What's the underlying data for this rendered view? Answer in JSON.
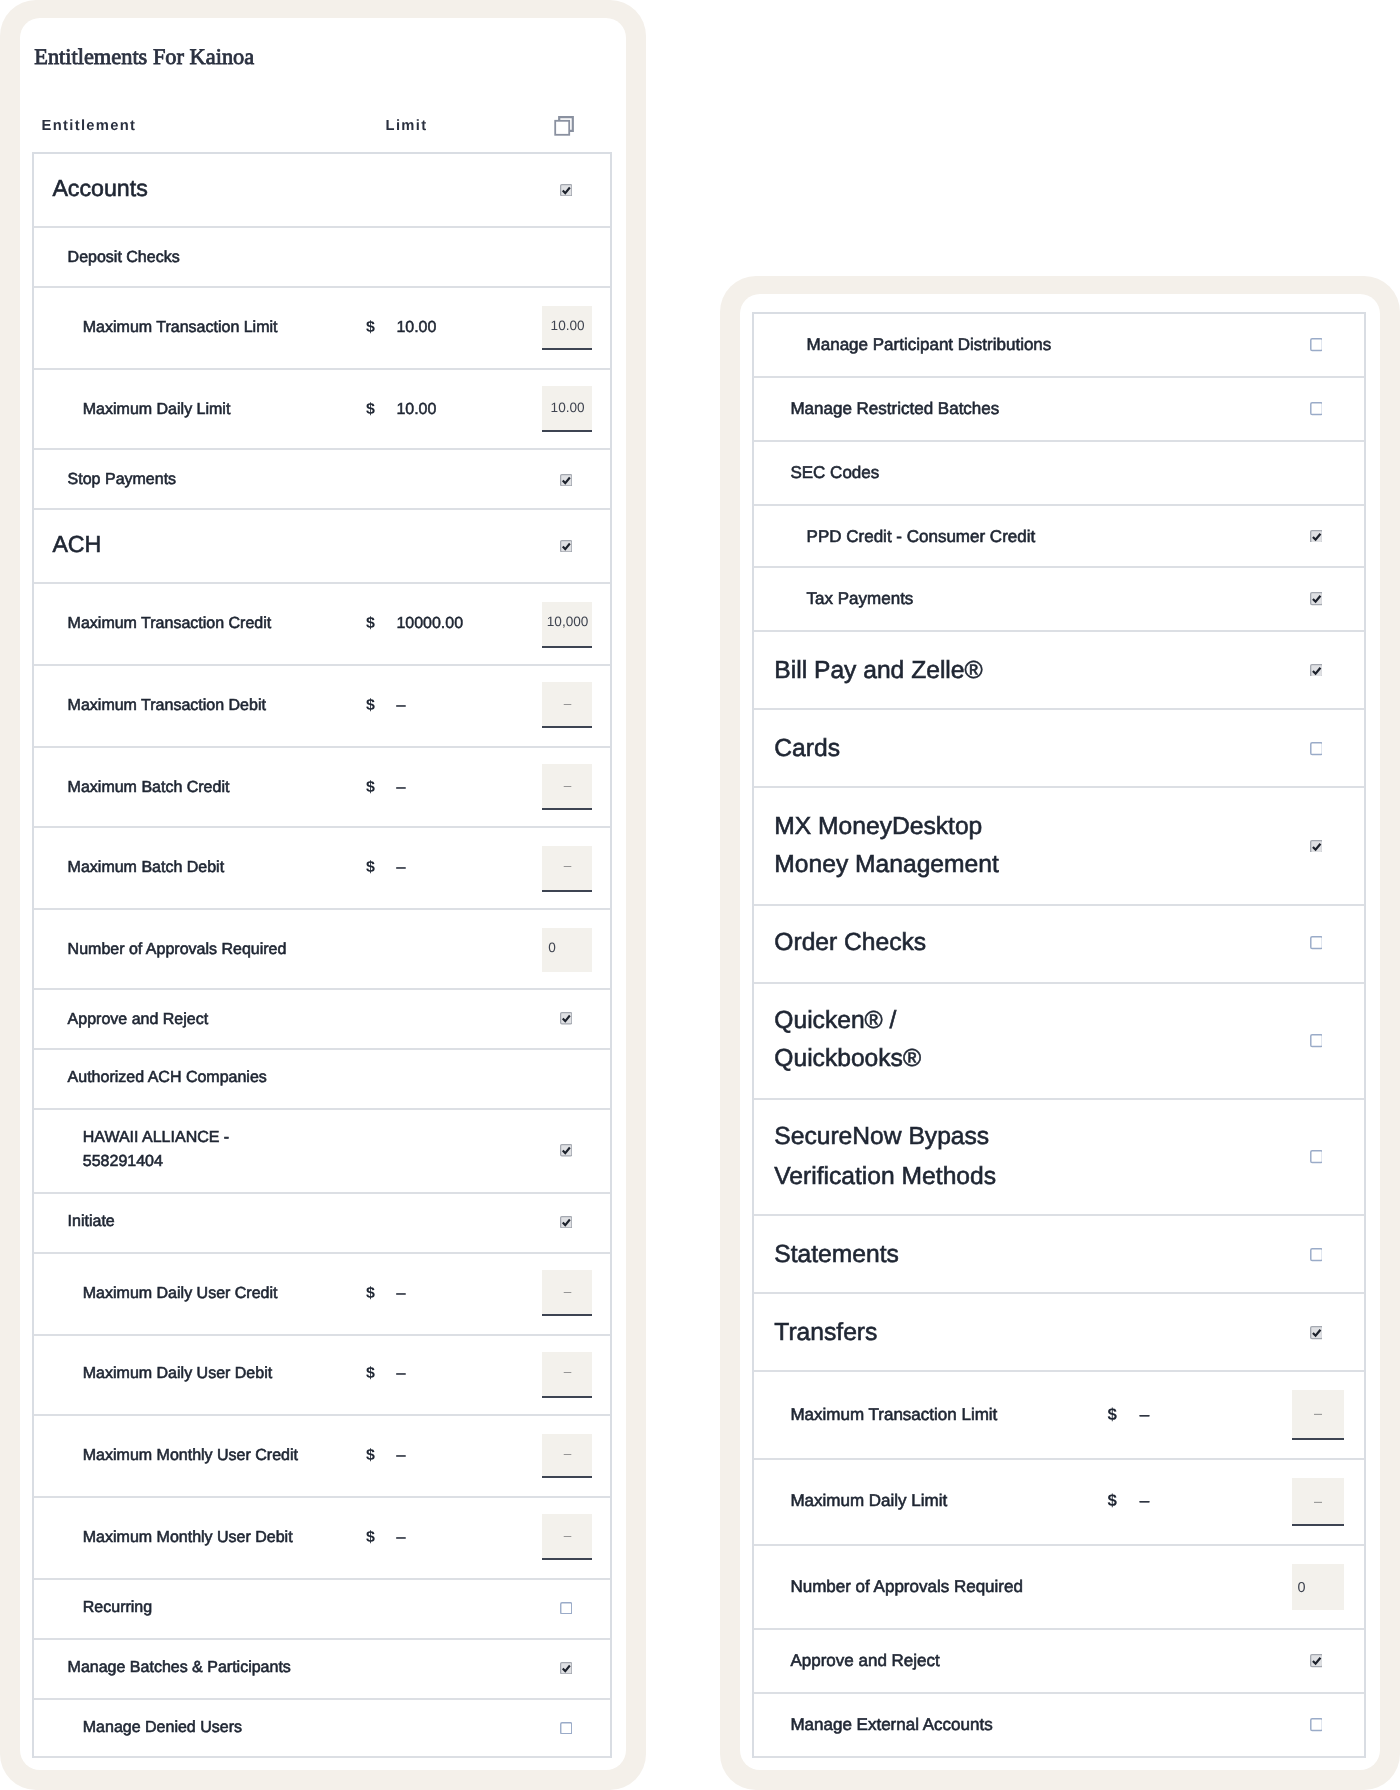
{
  "panels": [
    {
      "title": "Entitlements For Kainoa",
      "columns": [
        "Entitlement",
        "Limit"
      ],
      "rows": [
        {
          "label": "Accounts",
          "kind": "checkbox",
          "checked": true,
          "children": [
            {
              "label": "Deposit Checks",
              "kind": "group",
              "children": [
                {
                  "label": "Maximum Transaction Limit",
                  "kind": "amount",
                  "currency": "$",
                  "limit": "10.00",
                  "field": {
                    "value": "10.00"
                  }
                },
                {
                  "label": "Maximum Daily Limit",
                  "kind": "amount",
                  "currency": "$",
                  "limit": "10.00",
                  "field": {
                    "value": "10.00"
                  }
                }
              ]
            },
            {
              "label": "Stop Payments",
              "kind": "checkbox",
              "checked": true
            }
          ]
        },
        {
          "label": "ACH",
          "kind": "checkbox",
          "checked": true,
          "children": [
            {
              "label": "Maximum Transaction Credit",
              "kind": "amount",
              "currency": "$",
              "limit": "10000.00",
              "field": {
                "value": "10,000"
              }
            },
            {
              "label": "Maximum Transaction Debit",
              "kind": "amount",
              "currency": "$",
              "limit": "–",
              "field": {
                "placeholder": "–"
              }
            },
            {
              "label": "Maximum Batch Credit",
              "kind": "amount",
              "currency": "$",
              "limit": "–",
              "field": {
                "placeholder": "–"
              }
            },
            {
              "label": "Maximum Batch Debit",
              "kind": "amount",
              "currency": "$",
              "limit": "–",
              "field": {
                "placeholder": "–"
              }
            },
            {
              "label": "Number of Approvals Required",
              "kind": "count",
              "field": {
                "value": "0"
              }
            },
            {
              "label": "Approve and Reject",
              "kind": "checkbox",
              "checked": true
            },
            {
              "label": "Authorized ACH Companies",
              "kind": "group",
              "children": [
                {
                  "label": "HAWAII ALLIANCE - 558291404",
                  "kind": "checkbox",
                  "checked": true
                }
              ]
            },
            {
              "label": "Initiate",
              "kind": "checkbox",
              "checked": true,
              "children": [
                {
                  "label": "Maximum Daily User Credit",
                  "kind": "amount",
                  "currency": "$",
                  "limit": "–",
                  "field": {
                    "placeholder": "–"
                  }
                },
                {
                  "label": "Maximum Daily User Debit",
                  "kind": "amount",
                  "currency": "$",
                  "limit": "–",
                  "field": {
                    "placeholder": "–"
                  }
                },
                {
                  "label": "Maximum Monthly User Credit",
                  "kind": "amount",
                  "currency": "$",
                  "limit": "–",
                  "field": {
                    "placeholder": "–"
                  }
                },
                {
                  "label": "Maximum Monthly User Debit",
                  "kind": "amount",
                  "currency": "$",
                  "limit": "–",
                  "field": {
                    "placeholder": "–"
                  }
                },
                {
                  "label": "Recurring",
                  "kind": "checkbox",
                  "checked": false
                }
              ]
            },
            {
              "label": "Manage Batches & Participants",
              "kind": "checkbox",
              "checked": true,
              "children": [
                {
                  "label": "Manage Denied Users",
                  "kind": "checkbox",
                  "checked": false
                }
              ]
            }
          ]
        }
      ]
    },
    {
      "rows": [
        {
          "children": [
            {
              "children": [
                {
                  "label": "Manage Participant Distributions",
                  "kind": "checkbox",
                  "checked": false
                }
              ]
            },
            {
              "label": "Manage Restricted Batches",
              "kind": "checkbox",
              "checked": false
            },
            {
              "label": "SEC Codes",
              "kind": "group",
              "children": [
                {
                  "label": "PPD Credit - Consumer Credit",
                  "kind": "checkbox",
                  "checked": true
                },
                {
                  "label": "Tax Payments",
                  "kind": "checkbox",
                  "checked": true
                }
              ]
            }
          ]
        },
        {
          "label": "Bill Pay and Zelle®",
          "kind": "checkbox",
          "checked": true
        },
        {
          "label": "Cards",
          "kind": "checkbox",
          "checked": false
        },
        {
          "label": "MX MoneyDesktop Money Management",
          "kind": "checkbox",
          "checked": true
        },
        {
          "label": "Order Checks",
          "kind": "checkbox",
          "checked": false
        },
        {
          "label": "Quicken® / Quickbooks®",
          "kind": "checkbox",
          "checked": false
        },
        {
          "label": "SecureNow Bypass Verification Methods",
          "kind": "checkbox",
          "checked": false
        },
        {
          "label": "Statements",
          "kind": "checkbox",
          "checked": false
        },
        {
          "label": "Transfers",
          "kind": "checkbox",
          "checked": true,
          "children": [
            {
              "label": "Maximum Transaction Limit",
              "kind": "amount",
              "currency": "$",
              "limit": "–",
              "field": {
                "placeholder": "–"
              }
            },
            {
              "label": "Maximum Daily Limit",
              "kind": "amount",
              "currency": "$",
              "limit": "–",
              "field": {
                "placeholder": "–"
              }
            },
            {
              "label": "Number of Approvals Required",
              "kind": "count",
              "field": {
                "value": "0"
              }
            },
            {
              "label": "Approve and Reject",
              "kind": "checkbox",
              "checked": true
            },
            {
              "label": "Manage External Accounts",
              "kind": "checkbox",
              "checked": false
            }
          ]
        }
      ]
    }
  ]
}
